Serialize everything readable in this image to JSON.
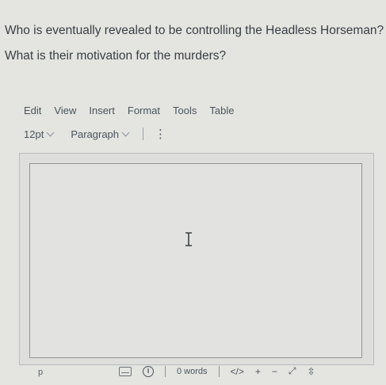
{
  "question": {
    "line1": "Who is eventually revealed to be controlling the Headless Horseman?",
    "line2": "What is their motivation for the murders?"
  },
  "menu": {
    "items": [
      "Edit",
      "View",
      "Insert",
      "Format",
      "Tools",
      "Table"
    ]
  },
  "toolbar": {
    "font_size": "12pt",
    "block_format": "Paragraph",
    "more_icon": "kebab-vertical-icon"
  },
  "editor": {
    "content": "",
    "cursor_icon": "ibeam-cursor-icon"
  },
  "statusbar": {
    "path": "p",
    "word_count": "0 words",
    "html_label": "</>",
    "plus": "+",
    "minus": "−",
    "expand": "⤢",
    "resize": "⇳"
  }
}
